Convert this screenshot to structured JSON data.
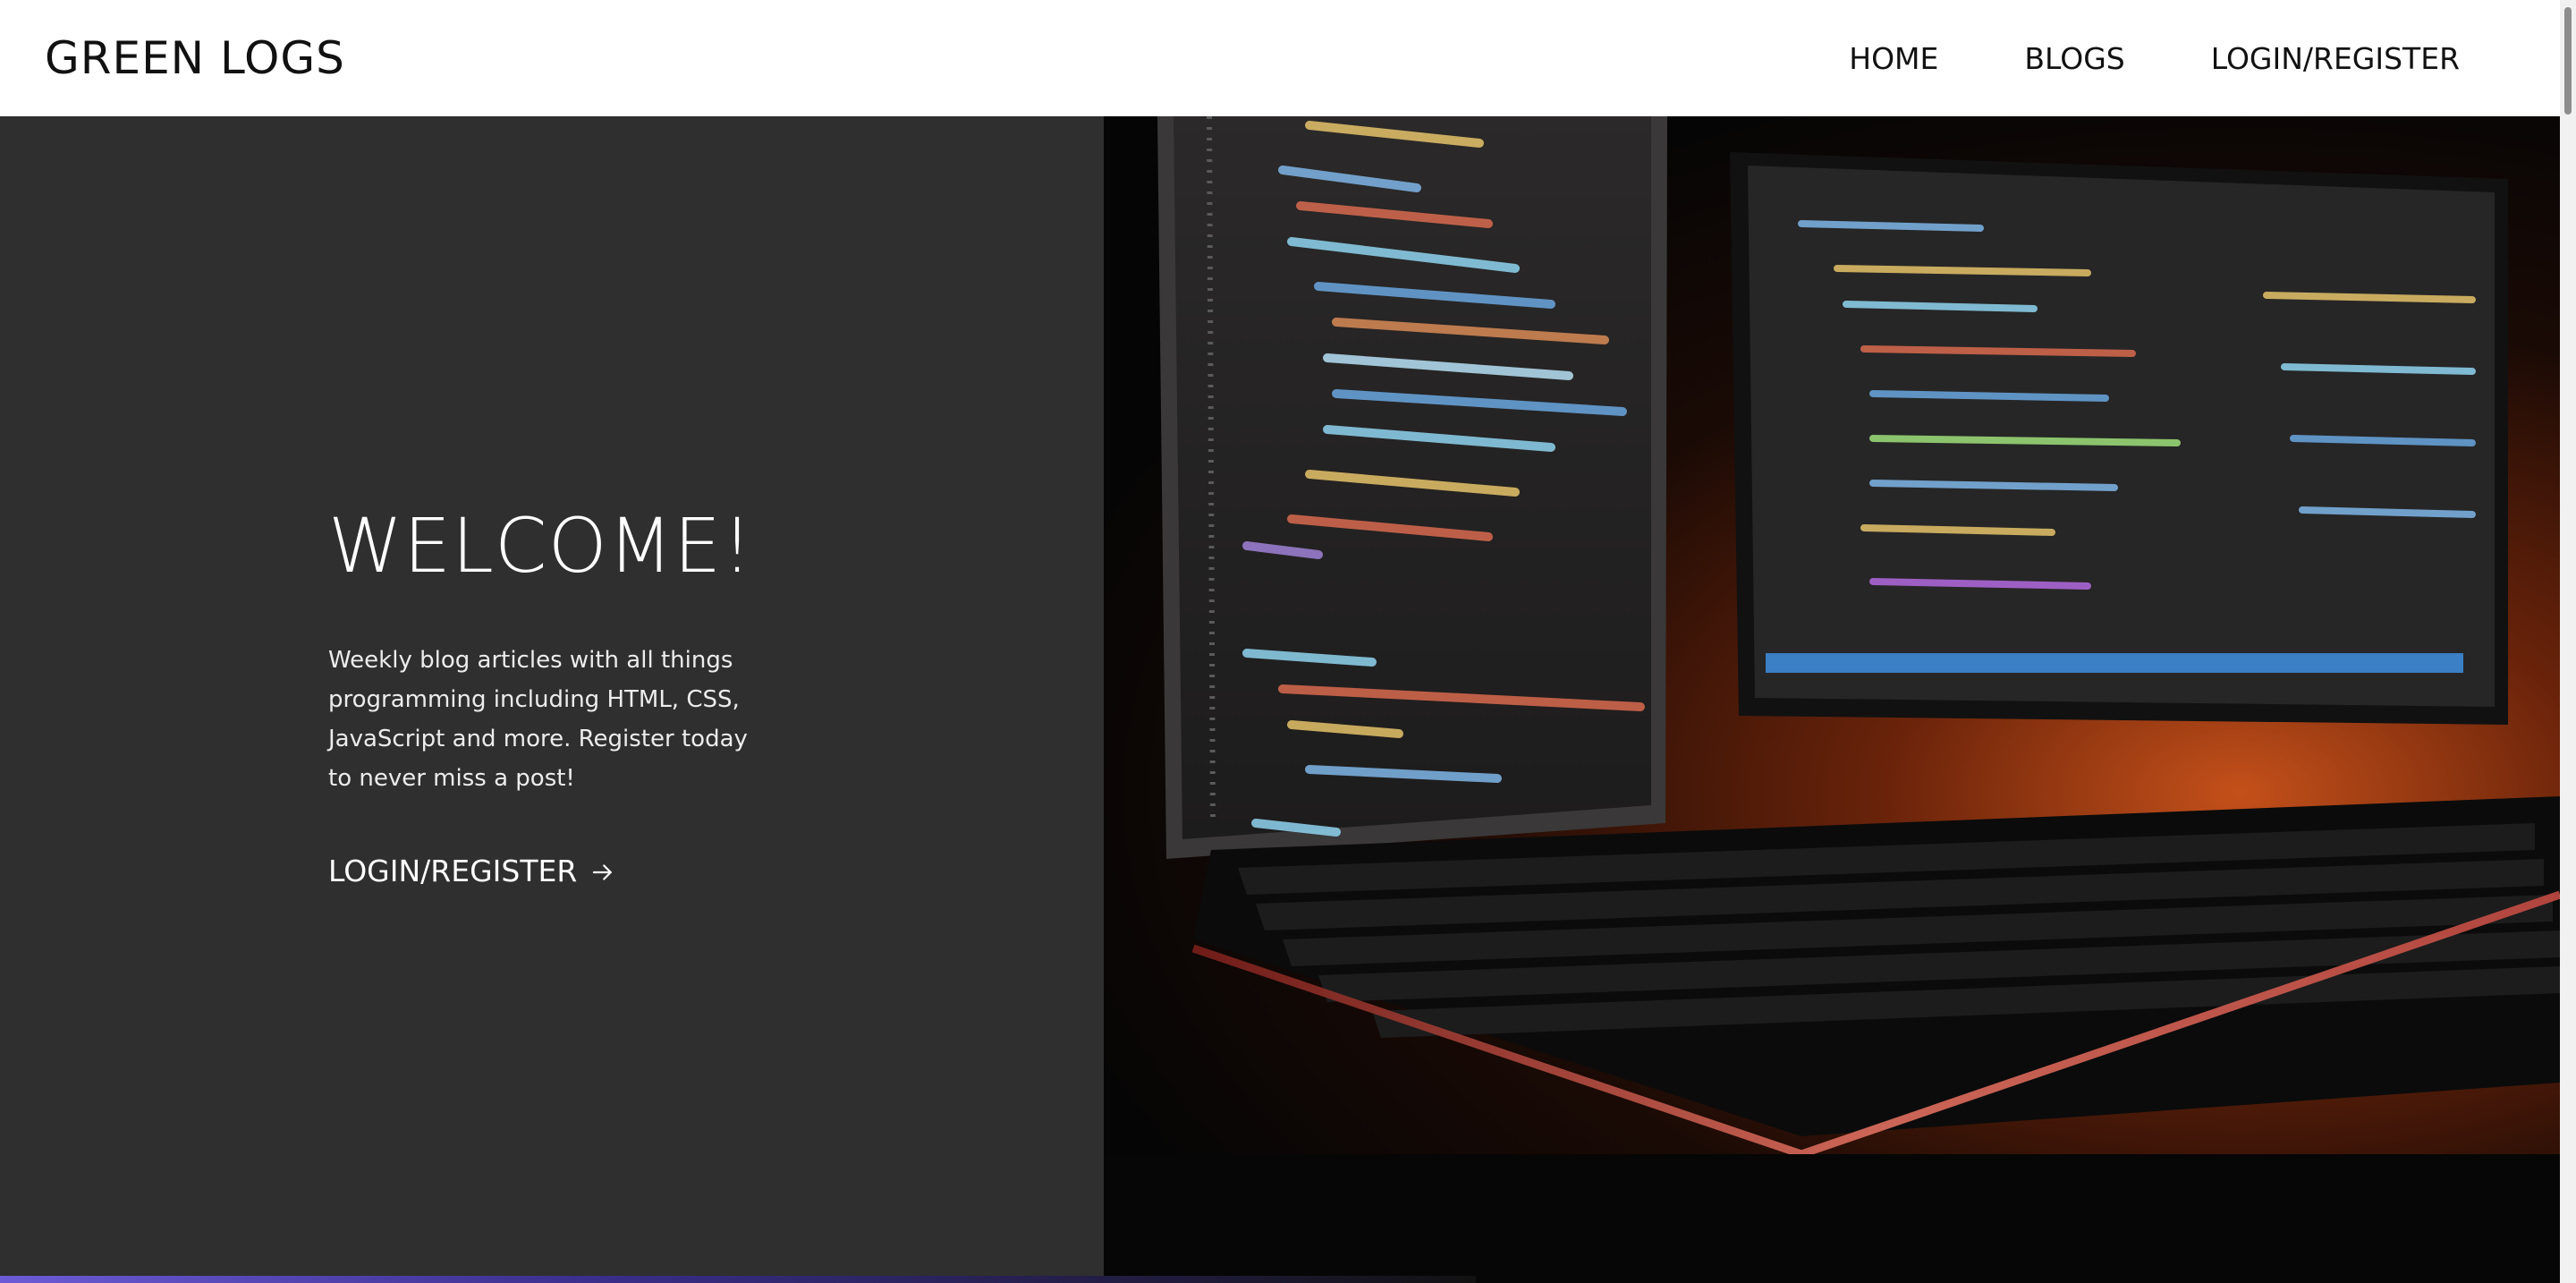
{
  "header": {
    "logo": "GREEN LOGS",
    "nav": [
      {
        "label": "HOME"
      },
      {
        "label": "BLOGS"
      },
      {
        "label": "LOGIN/REGISTER"
      }
    ]
  },
  "hero": {
    "title": "WELCOME!",
    "blurb": "Weekly blog articles with all things programming including HTML, CSS, JavaScript and more. Register today to never miss a post!",
    "cta_label": "LOGIN/REGISTER",
    "cta_icon": "arrow-right-icon",
    "image_subject": "computer-monitors-keyboard-photo"
  },
  "colors": {
    "hero_left_bg": "#2f2f2f",
    "header_bg": "#ffffff",
    "text_dark": "#111111",
    "text_light": "#ffffff"
  }
}
